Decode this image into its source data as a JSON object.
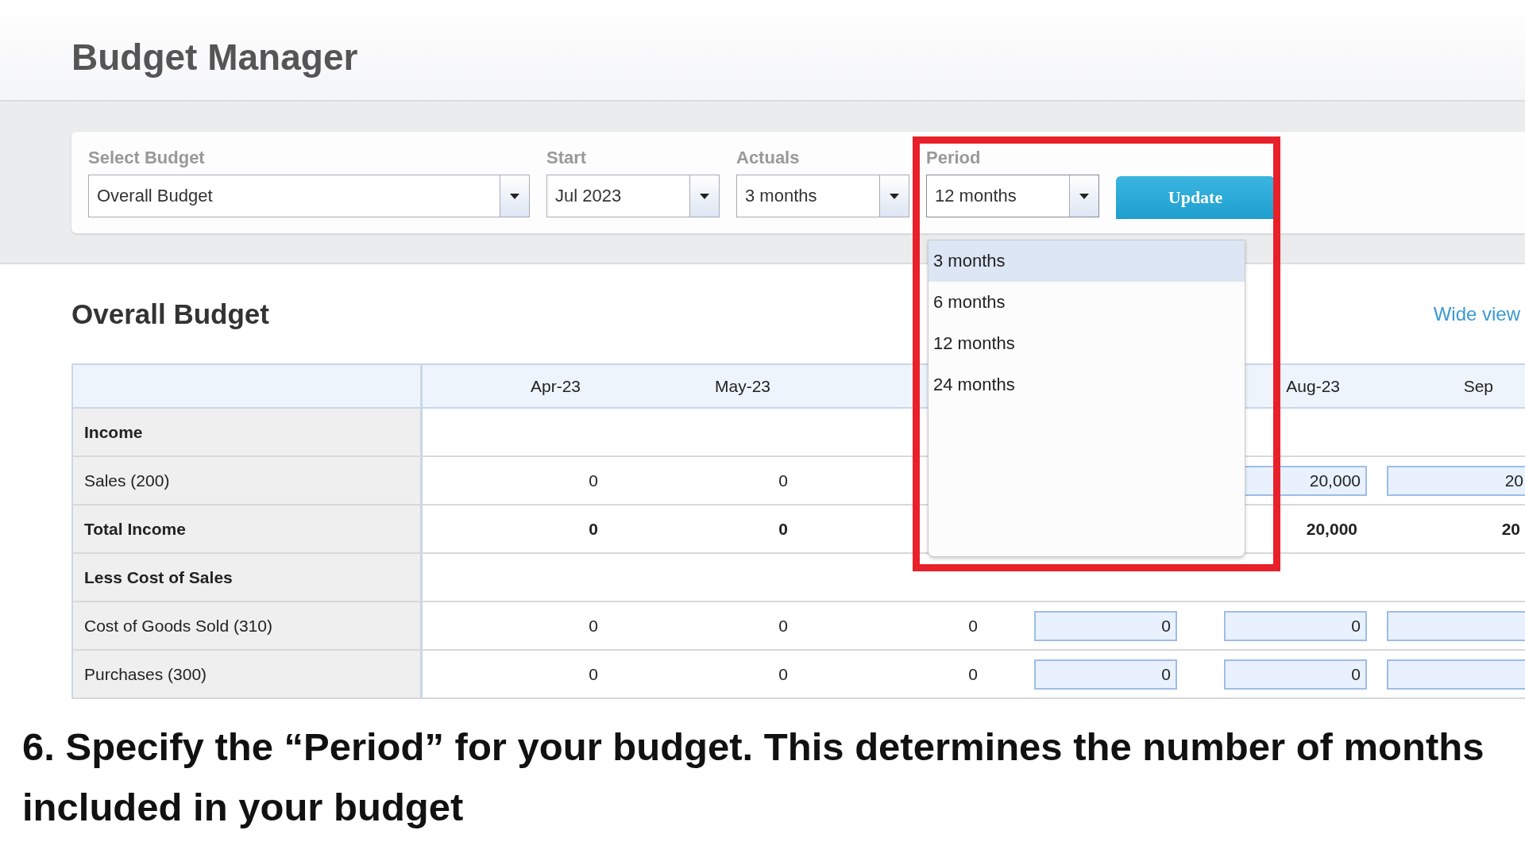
{
  "header": {
    "title": "Budget Manager"
  },
  "filters": [
    {
      "label": "Select Budget",
      "value": "Overall Budget",
      "expanded": false
    },
    {
      "label": "Start",
      "value": "Jul 2023",
      "expanded": false
    },
    {
      "label": "Actuals",
      "value": "3 months",
      "expanded": false
    },
    {
      "label": "Period",
      "value": "12 months",
      "expanded": true
    }
  ],
  "update_button": "Update",
  "period_menu": [
    {
      "label": "3 months",
      "selected": true
    },
    {
      "label": "6 months",
      "selected": false
    },
    {
      "label": "12 months",
      "selected": false
    },
    {
      "label": "24 months",
      "selected": false
    }
  ],
  "budget": {
    "title": "Overall Budget",
    "wide_view_link": "Wide view",
    "columns": [
      "Apr-23",
      "May-23",
      null,
      null,
      "Aug-23",
      "Sep"
    ],
    "rows": [
      {
        "label": "Income",
        "kind": "heading"
      },
      {
        "label": "Sales (200)",
        "kind": "item",
        "cells": [
          {
            "kind": "text",
            "value": "0"
          },
          {
            "kind": "text",
            "value": "0"
          },
          null,
          null,
          {
            "kind": "input",
            "value": "20,000"
          },
          {
            "kind": "input",
            "value": "20"
          }
        ]
      },
      {
        "label": "Total Income",
        "kind": "total",
        "cells": [
          {
            "kind": "text",
            "value": "0"
          },
          {
            "kind": "text",
            "value": "0"
          },
          null,
          null,
          {
            "kind": "text",
            "value": "20,000"
          },
          {
            "kind": "text",
            "value": "20"
          }
        ]
      },
      {
        "label": "Less Cost of Sales",
        "kind": "heading"
      },
      {
        "label": "Cost of Goods Sold (310)",
        "kind": "item",
        "cells": [
          {
            "kind": "text",
            "value": "0"
          },
          {
            "kind": "text",
            "value": "0"
          },
          {
            "kind": "text",
            "value": "0"
          },
          {
            "kind": "input",
            "value": "0"
          },
          {
            "kind": "input",
            "value": "0"
          },
          {
            "kind": "input"
          }
        ]
      },
      {
        "label": "Purchases (300)",
        "kind": "item",
        "cells": [
          {
            "kind": "text",
            "value": "0"
          },
          {
            "kind": "text",
            "value": "0"
          },
          {
            "kind": "text",
            "value": "0"
          },
          {
            "kind": "input",
            "value": "0"
          },
          {
            "kind": "input",
            "value": "0"
          },
          {
            "kind": "input"
          }
        ]
      }
    ]
  },
  "caption": "6. Specify the “Period” for your budget. This determines the number of months included in your budget"
}
